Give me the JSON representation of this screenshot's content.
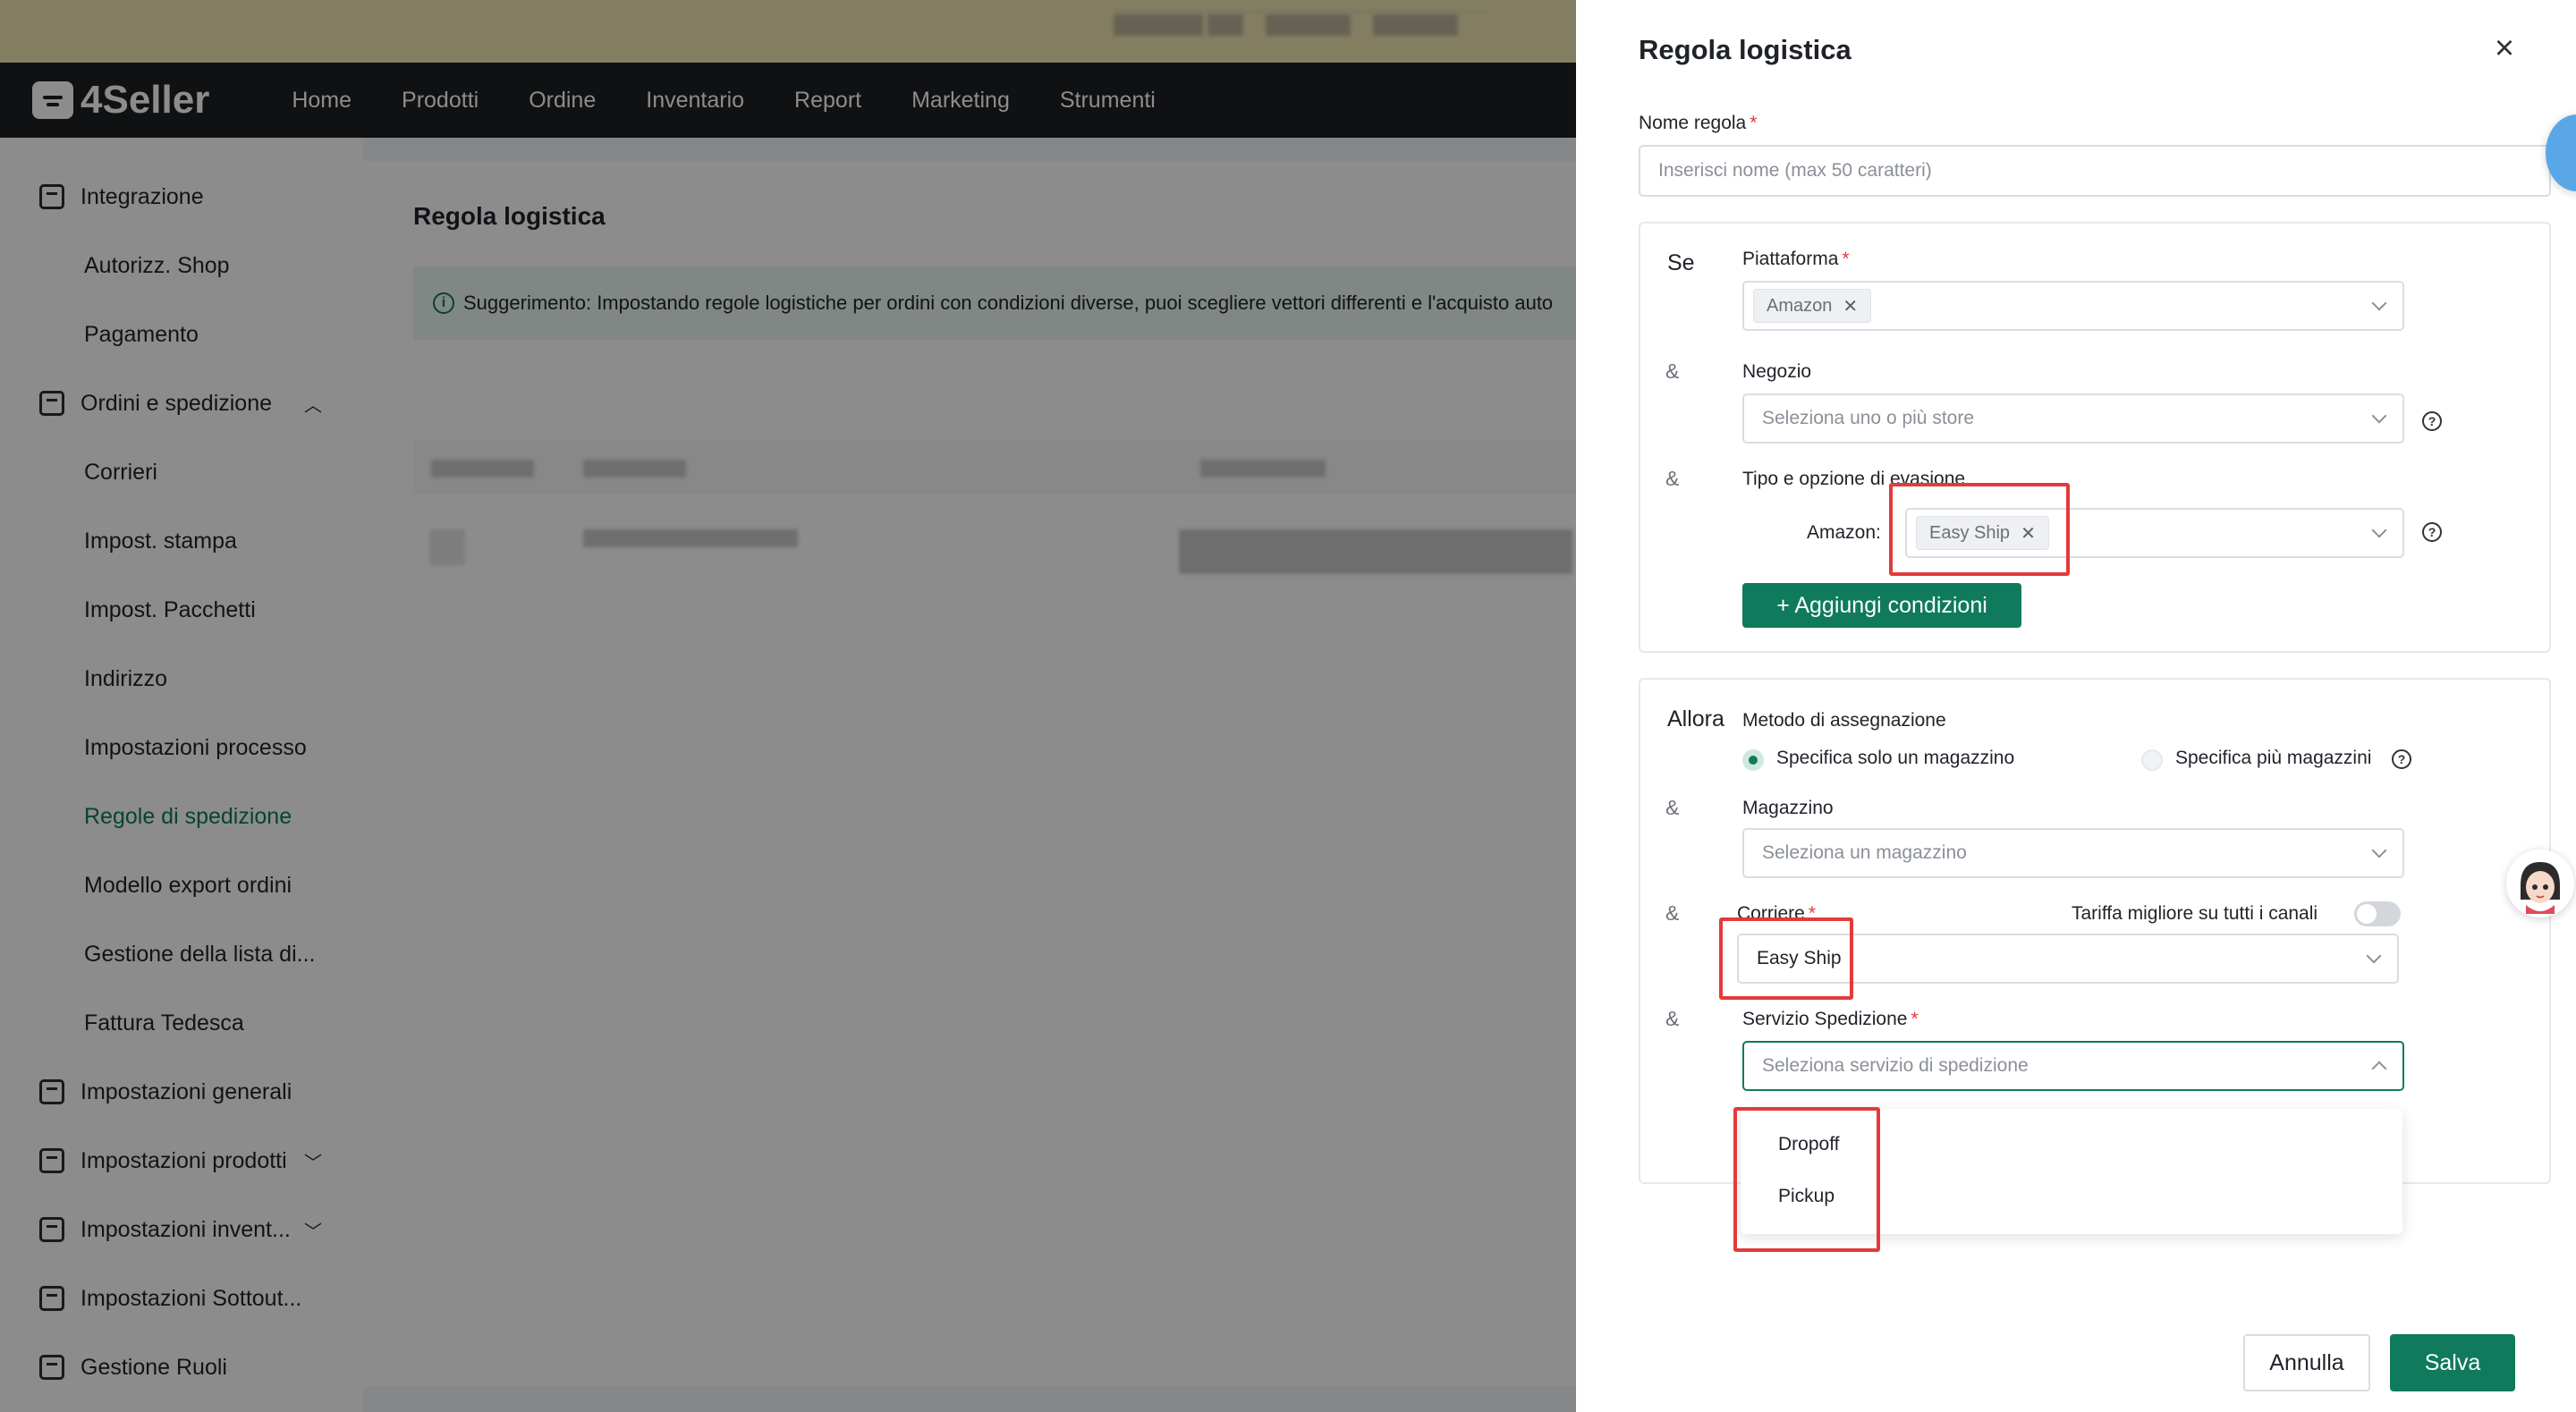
{
  "app": {
    "logo": "4Seller",
    "nav": [
      "Home",
      "Prodotti",
      "Ordine",
      "Inventario",
      "Report",
      "Marketing",
      "Strumenti"
    ]
  },
  "sidebar": {
    "items": [
      {
        "label": "Integrazione",
        "type": "parent",
        "icon": "store-icon"
      },
      {
        "label": "Autorizz. Shop",
        "type": "child"
      },
      {
        "label": "Pagamento",
        "type": "child"
      },
      {
        "label": "Ordini e spedizione",
        "type": "parent",
        "icon": "order-icon",
        "chevron": "^"
      },
      {
        "label": "Corrieri",
        "type": "child"
      },
      {
        "label": "Impost. stampa",
        "type": "child"
      },
      {
        "label": "Impost. Pacchetti",
        "type": "child"
      },
      {
        "label": "Indirizzo",
        "type": "child"
      },
      {
        "label": "Impostazioni processo",
        "type": "child"
      },
      {
        "label": "Regole di spedizione",
        "type": "child",
        "active": true
      },
      {
        "label": "Modello export ordini",
        "type": "child"
      },
      {
        "label": "Gestione della lista di...",
        "type": "child"
      },
      {
        "label": "Fattura Tedesca",
        "type": "child"
      },
      {
        "label": "Impostazioni generali",
        "type": "parent",
        "icon": "settings-icon"
      },
      {
        "label": "Impostazioni prodotti",
        "type": "parent",
        "icon": "product-icon",
        "chevron": "v"
      },
      {
        "label": "Impostazioni invent...",
        "type": "parent",
        "icon": "inventory-icon",
        "chevron": "v"
      },
      {
        "label": "Impostazioni Sottout...",
        "type": "parent",
        "icon": "subaccount-icon"
      },
      {
        "label": "Gestione Ruoli",
        "type": "parent",
        "icon": "user-icon"
      }
    ]
  },
  "content": {
    "title": "Regola logistica",
    "tip": "Suggerimento: Impostando regole logistiche per ordini con condizioni diverse, puoi scegliere vettori differenti e l'acquisto auto"
  },
  "drawer": {
    "title": "Regola logistica",
    "rule_name": {
      "label": "Nome regola",
      "placeholder": "Inserisci nome (max 50 caratteri)"
    },
    "if_section": {
      "word": "Se",
      "amp": "&",
      "platform": {
        "label": "Piattaforma",
        "tag": "Amazon"
      },
      "store": {
        "label": "Negozio",
        "placeholder": "Seleziona uno o più store"
      },
      "fulfillment": {
        "label": "Tipo e opzione di evasione",
        "platform_label": "Amazon:",
        "tag": "Easy Ship"
      },
      "add_button": "+ Aggiungi condizioni"
    },
    "then_section": {
      "word": "Allora",
      "amp": "&",
      "method": {
        "label": "Metodo di assegnazione",
        "option_single": "Specifica solo un magazzino",
        "option_multi": "Specifica più magazzini",
        "selected": "Specifica solo un magazzino"
      },
      "warehouse": {
        "label": "Magazzino",
        "placeholder": "Seleziona un magazzino"
      },
      "carrier": {
        "label": "Corriere",
        "value": "Easy Ship",
        "best_rate_label": "Tariffa migliore su tutti i canali",
        "best_rate_enabled": false
      },
      "service": {
        "label": "Servizio Spedizione",
        "placeholder": "Seleziona servizio di spedizione",
        "options": [
          "Dropoff",
          "Pickup"
        ]
      }
    },
    "footer": {
      "cancel": "Annulla",
      "save": "Salva"
    },
    "colors": {
      "accent": "#0f7a5c",
      "required": "#e23b3b",
      "highlight": "#e23b3b"
    }
  }
}
